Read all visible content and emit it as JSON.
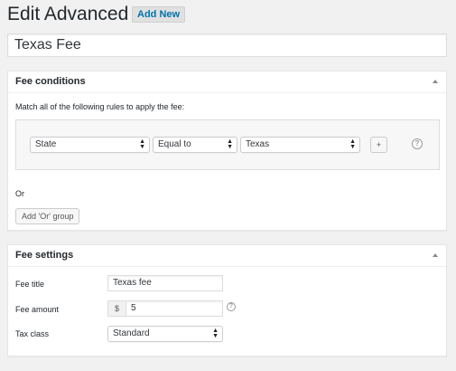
{
  "header": {
    "title": "Edit Advanced Fee",
    "add_new": "Add New"
  },
  "fee_name": "Texas Fee",
  "conditions": {
    "title": "Fee conditions",
    "match_text": "Match all of the following rules to apply the fee:",
    "rule": {
      "field": "State",
      "operator": "Equal to",
      "value": "Texas",
      "add_label": "+"
    },
    "or_text": "Or",
    "or_button": "Add 'Or' group"
  },
  "settings": {
    "title": "Fee settings",
    "fee_title_label": "Fee title",
    "fee_title_value": "Texas fee",
    "fee_amount_label": "Fee amount",
    "currency_symbol": "$",
    "fee_amount_value": "5",
    "tax_class_label": "Tax class",
    "tax_class_value": "Standard"
  },
  "icons": {
    "help": "question-circle-icon",
    "toggle": "collapse-arrow-icon",
    "select_arrow": "select-updown-arrow-icon"
  },
  "colors": {
    "link": "#0073aa",
    "background": "#f1f1f1"
  }
}
